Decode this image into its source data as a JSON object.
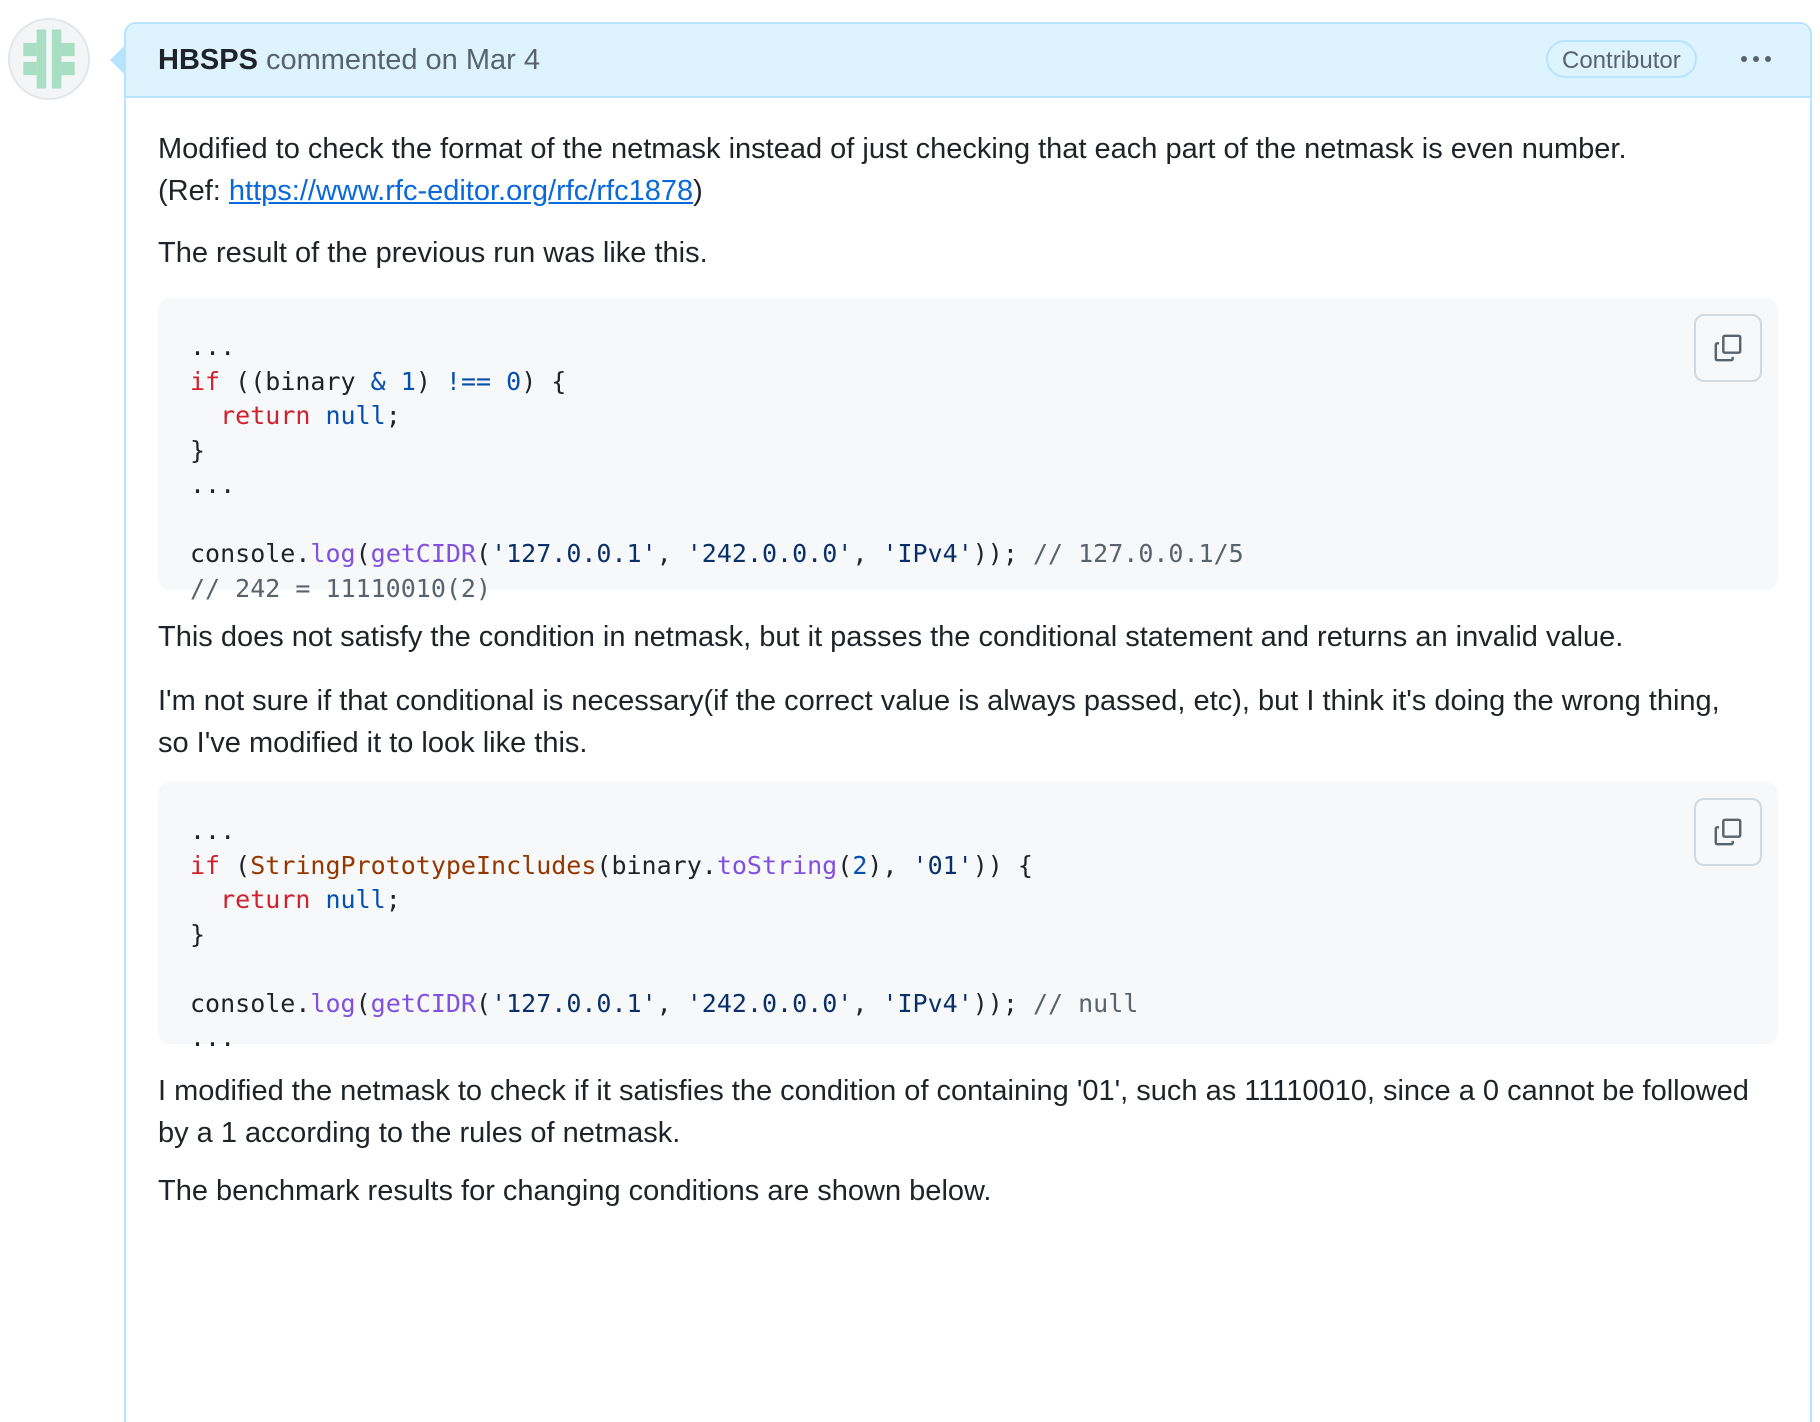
{
  "comment": {
    "author": "HBSPS",
    "action": "commented on",
    "date": "Mar 4",
    "role_badge": "Contributor",
    "menu_icon": "kebab-horizontal-icon"
  },
  "body": {
    "p1_line1": "Modified to check the format of the netmask instead of just checking that each part of the netmask is even number.",
    "p1_ref_prefix": "(Ref: ",
    "p1_ref_link": "https://www.rfc-editor.org/rfc/rfc1878",
    "p1_ref_suffix": ")",
    "p2": "The result of the previous run was like this.",
    "code1": {
      "l1": "...",
      "l2_kw": "if",
      "l2_a": " ((binary ",
      "l2_op1": "&",
      "l2_b": " ",
      "l2_num1": "1",
      "l2_c": ") ",
      "l2_op2": "!==",
      "l2_d": " ",
      "l2_num2": "0",
      "l2_e": ") {",
      "l3_kw": "return",
      "l3_null": "null",
      "l3_end": ";",
      "l4": "}",
      "l5": "...",
      "l7_a": "console.",
      "l7_log": "log",
      "l7_b": "(",
      "l7_fn": "getCIDR",
      "l7_c": "(",
      "l7_s1": "'127.0.0.1'",
      "l7_d": ", ",
      "l7_s2": "'242.0.0.0'",
      "l7_e": ", ",
      "l7_s3": "'IPv4'",
      "l7_f": ")); ",
      "l7_cm": "// 127.0.0.1/5",
      "l8_cm": "// 242 = 11110010(2)"
    },
    "p3": "This does not satisfy the condition in netmask, but it passes the conditional statement and returns an invalid value.",
    "p4_line1": "I'm not sure if that conditional is necessary(if the correct value is always passed, etc), but I think it's doing the wrong thing,",
    "p4_line2": "so I've modified it to look like this.",
    "code2": {
      "l1": "...",
      "l2_kw": "if",
      "l2_a": " (",
      "l2_fn": "StringPrototypeIncludes",
      "l2_b": "(binary.",
      "l2_tostring": "toString",
      "l2_c": "(",
      "l2_num": "2",
      "l2_d": "), ",
      "l2_str": "'01'",
      "l2_e": ")) {",
      "l3_kw": "return",
      "l3_null": "null",
      "l3_end": ";",
      "l4": "}",
      "l6_a": "console.",
      "l6_log": "log",
      "l6_b": "(",
      "l6_fn": "getCIDR",
      "l6_c": "(",
      "l6_s1": "'127.0.0.1'",
      "l6_d": ", ",
      "l6_s2": "'242.0.0.0'",
      "l6_e": ", ",
      "l6_s3": "'IPv4'",
      "l6_f": ")); ",
      "l6_cm": "// null",
      "l7": "..."
    },
    "p5_line1": "I modified the netmask to check if it satisfies the condition of containing '01', such as 11110010, since a 0 cannot be followed",
    "p5_line2": "by a 1 according to the rules of netmask.",
    "p6": "The benchmark results for changing conditions are shown below."
  },
  "colors": {
    "header_bg": "#ddf4ff",
    "border": "#b6e3ff",
    "link": "#0969da",
    "code_bg": "#f6f8fa",
    "keyword": "#cf222e",
    "constant": "#0550ae",
    "function": "#8250df",
    "string": "#0a3069",
    "comment": "#59636e"
  },
  "icons": {
    "avatar": "identicon-avatar",
    "copy": "copy-icon"
  }
}
